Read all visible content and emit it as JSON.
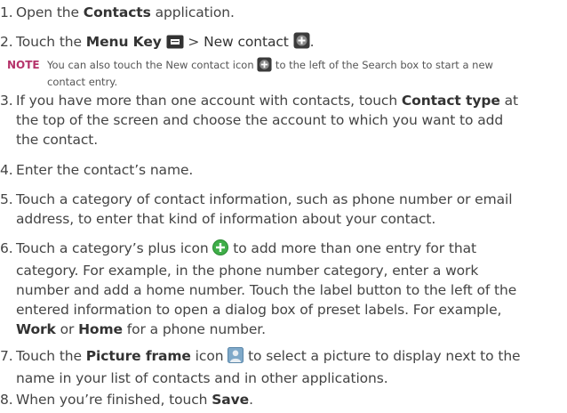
{
  "steps": [
    {
      "num": "1.",
      "pre": "Open the ",
      "bold": "Contacts",
      "post": " application."
    },
    {
      "num": "2.",
      "pre": "Touch the ",
      "bold1": "Menu Key",
      "mid": " > ",
      "bold2": "New contact",
      "post": ".",
      "icons": [
        "menu-key-icon",
        "new-contact-icon"
      ]
    },
    {
      "num": "3.",
      "line1_pre": "If you have more than one account with contacts, touch ",
      "line1_bold": "Contact type",
      "line1_post": " at",
      "line2": "the top of the screen and choose the account to which you want to add",
      "line3": "the contact."
    },
    {
      "num": "4.",
      "text": "Enter the contact’s name."
    },
    {
      "num": "5.",
      "line1": "Touch a category of contact information, such as phone number or email",
      "line2": "address, to enter that kind of information about your contact."
    },
    {
      "num": "6.",
      "line1_pre": "Touch a category’s plus icon ",
      "line1_post": " to add more than one entry for that",
      "line2": "category. For example, in the phone number category, enter a work",
      "line3": "number and add a home number. Touch the label button to the left of the",
      "line4": "entered information to open a dialog box of preset labels. For example,",
      "line5_bold1": "Work",
      "line5_mid": " or ",
      "line5_bold2": "Home",
      "line5_post": " for a phone number.",
      "icons": [
        "plus-icon"
      ]
    },
    {
      "num": "7.",
      "line1_pre": "Touch the ",
      "line1_bold": "Picture frame",
      "line1_mid": " icon ",
      "line1_post": " to select a picture to display next to the",
      "line2": "name in your list of contacts and in other applications.",
      "icons": [
        "picture-frame-icon"
      ]
    },
    {
      "num": "8.",
      "pre": "When you’re finished, touch ",
      "bold": "Save",
      "post": "."
    }
  ],
  "note": {
    "label": "NOTE",
    "line1_pre": "You can also touch the New contact icon ",
    "line1_post": " to the left of the Search box to start a new",
    "line2": "contact entry.",
    "icons": [
      "new-contact-icon"
    ]
  },
  "colors": {
    "text": "#444444",
    "note_label": "#b5336a",
    "plus_icon": "#3fae49"
  }
}
